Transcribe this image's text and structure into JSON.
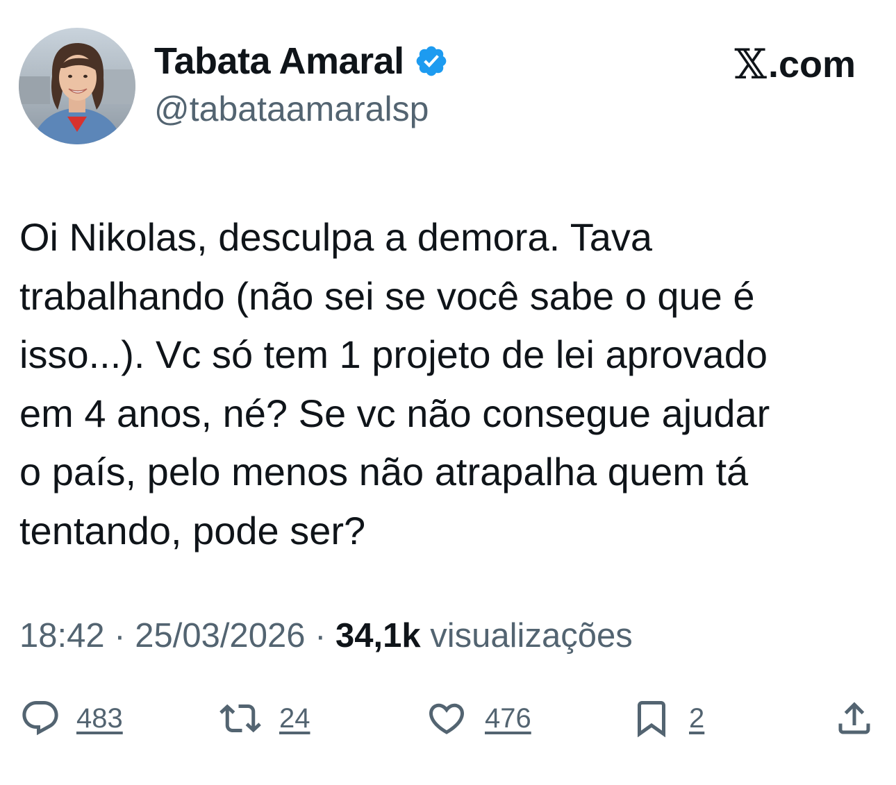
{
  "account": {
    "display_name": "Tabata Amaral",
    "handle": "@tabataamaralsp",
    "verified": true,
    "verified_color": "#1d9bf0"
  },
  "brand": {
    "x_symbol": "𝕏",
    "suffix": ".com"
  },
  "tweet": {
    "text": "Oi Nikolas, desculpa a demora. Tava\ntrabalhando (não sei se você sabe o que é\nisso...). Vc só tem 1 projeto de lei aprovado\nem 4 anos, né? Se vc não consegue ajudar\no país, pelo menos não atrapalha quem tá\ntentando, pode ser?",
    "time": "18:42",
    "separator": "·",
    "date": "25/03/2026",
    "views_count": "34,1k",
    "views_label": "visualizações"
  },
  "actions": {
    "replies": {
      "icon": "reply-icon",
      "count": "483"
    },
    "reposts": {
      "icon": "repost-icon",
      "count": "24"
    },
    "likes": {
      "icon": "heart-icon",
      "count": "476"
    },
    "bookmarks": {
      "icon": "bookmark-icon",
      "count": "2"
    },
    "share": {
      "icon": "share-icon"
    }
  },
  "colors": {
    "text_primary": "#0f1419",
    "text_secondary": "#536471",
    "background": "#ffffff"
  }
}
